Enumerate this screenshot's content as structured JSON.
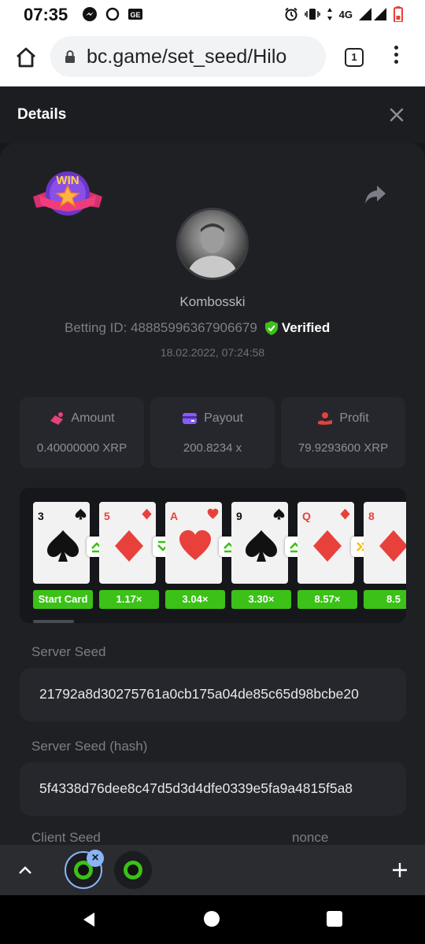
{
  "status_bar": {
    "time": "07:35",
    "network": "4G",
    "icons_left": [
      "messenger-icon",
      "circle-icon",
      "ge-icon"
    ],
    "icons_right": [
      "alarm-icon",
      "vibrate-icon",
      "data-arrows-icon",
      "signal-icon",
      "battery-icon"
    ]
  },
  "browser": {
    "url": "bc.game/set_seed/Hilo",
    "tab_count": "1"
  },
  "details": {
    "title": "Details"
  },
  "player": {
    "username": "Kombosski",
    "betting_id_label": "Betting ID: 48885996367906679",
    "verified_label": "Verified",
    "datetime": "18.02.2022, 07:24:58",
    "badge": "WIN"
  },
  "stats": {
    "amount": {
      "label": "Amount",
      "value": "0.40000000 XRP"
    },
    "payout": {
      "label": "Payout",
      "value": "200.8234 x"
    },
    "profit": {
      "label": "Profit",
      "value": "79.9293600 XRP"
    }
  },
  "cards": [
    {
      "rank": "3",
      "suit": "spade",
      "color": "#111111",
      "multiplier": "Start Card",
      "arrow": "up"
    },
    {
      "rank": "5",
      "suit": "diamond",
      "color": "#e8413c",
      "multiplier": "1.17×",
      "arrow": "down"
    },
    {
      "rank": "A",
      "suit": "heart",
      "color": "#e8413c",
      "multiplier": "3.04×",
      "arrow": "up"
    },
    {
      "rank": "9",
      "suit": "spade",
      "color": "#111111",
      "multiplier": "3.30×",
      "arrow": "up"
    },
    {
      "rank": "Q",
      "suit": "diamond",
      "color": "#e8413c",
      "multiplier": "8.57×",
      "arrow": "skip"
    },
    {
      "rank": "8",
      "suit": "diamond",
      "color": "#e8413c",
      "multiplier": "8.5",
      "arrow": null
    }
  ],
  "seeds": {
    "server_seed_label": "Server Seed",
    "server_seed": "21792a8d30275761a0cb175a04de85c65d98bcbe20",
    "server_seed_hash_label": "Server Seed (hash)",
    "server_seed_hash": "5f4338d76dee8c47d5d3d4dfe0339e5fa9a4815f5a8",
    "client_seed_label": "Client Seed",
    "nonce_label": "nonce"
  },
  "colors": {
    "accent_green": "#3bc117",
    "verified_green": "#3bc117",
    "background": "#1f2024",
    "card_red": "#e8413c"
  }
}
